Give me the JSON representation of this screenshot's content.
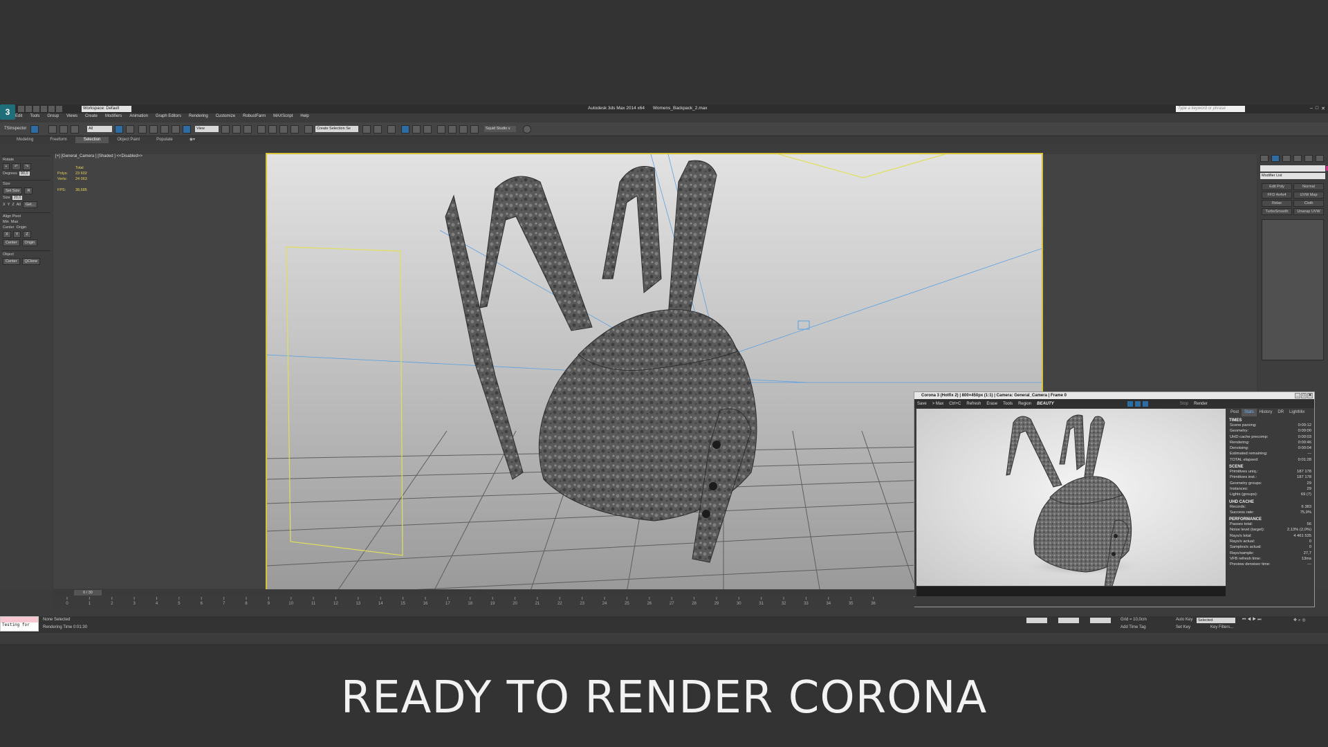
{
  "app": {
    "window_title": "Autodesk 3ds Max  2014 x64",
    "file_name": "Womens_Backpack_2.max",
    "workspace": "Workspace: Default",
    "search_placeholder": "Type a keyword or phrase"
  },
  "menu": [
    "Edit",
    "Tools",
    "Group",
    "Views",
    "Create",
    "Modifiers",
    "Animation",
    "Graph Editors",
    "Rendering",
    "Customize",
    "RobustFarm",
    "MAXScript",
    "Help"
  ],
  "toolbar": {
    "tsinspector": "TSInspector",
    "selection_filter": "All",
    "ref_coord": "View",
    "named_selection": "Create Selection Se",
    "squid": "Squid Studio v"
  },
  "ribbon_tabs": [
    "Modeling",
    "Freeform",
    "Selection",
    "Object Paint",
    "Populate"
  ],
  "ribbon_active": "Selection",
  "left_panel": {
    "rotate_title": "Rotate",
    "degrees_label": "Degrees",
    "degrees_value": "90,0",
    "size_title": "Size",
    "set_size": "Set Size",
    "r_label": "R",
    "size_label": "Size",
    "size_value": "20,0",
    "x": "X",
    "y": "Y",
    "z": "Z",
    "all": "All",
    "get": "Get...",
    "align_title": "Align Pivot",
    "min": "Min",
    "max": "Max",
    "center": "Center",
    "origin": "Origin",
    "object_title": "Object",
    "qclone": "QClone"
  },
  "viewport": {
    "label": "[+] [General_Camera ] [Shaded ]  <<Disabled>>",
    "stats_header": "Total",
    "polys_label": "Polys:",
    "polys_value": "23 602",
    "verts_label": "Verts:",
    "verts_value": "24 063",
    "fps_label": "FPS:",
    "fps_value": "38,685"
  },
  "right_panel": {
    "modifier_list": "Modifier List",
    "buttons": [
      "Edit Poly",
      "Normal",
      "FFD 4x4x4",
      "UVW Map",
      "Relax",
      "Cloth",
      "TurboSmooth",
      "Unwrap UVW"
    ],
    "swatch_color": "#d8348b"
  },
  "corona": {
    "title": "Corona 3 (Hotfix 2) | 800×450px (1:1) | Camera: General_Camera | Frame 0",
    "toolbar": [
      "Save",
      "> Max",
      "Ctrl+C",
      "Refresh",
      "Erase",
      "Tools",
      "Region"
    ],
    "beauty": "BEAUTY",
    "stop": "Stop",
    "render": "Render",
    "tabs": [
      "Post",
      "Stats",
      "History",
      "DR",
      "LightMix"
    ],
    "active_tab": "Stats",
    "sections": [
      {
        "title": "TIMES",
        "rows": [
          [
            "Scene parsing:",
            "0:00:12"
          ],
          [
            "Geometry:",
            "0:00:00"
          ],
          [
            "UHD cache precomp:",
            "0:00:03"
          ],
          [
            "Rendering:",
            "0:00:46"
          ],
          [
            "Denoising:",
            "0:00:04"
          ],
          [
            "Estimated remaining:",
            "---"
          ],
          [
            "TOTAL elapsed:",
            "0:01:28"
          ]
        ]
      },
      {
        "title": "SCENE",
        "rows": [
          [
            "Primitives uniq.:",
            "187 178"
          ],
          [
            "Primitives inst.:",
            "187 178"
          ],
          [
            "Geometry groups:",
            "29"
          ],
          [
            "Instances:",
            "29"
          ],
          [
            "Lights (groups):",
            "69 (7)"
          ]
        ]
      },
      {
        "title": "UHD CACHE",
        "rows": [
          [
            "Records:",
            "6 383"
          ],
          [
            "Success rate:",
            "75,9%"
          ]
        ]
      },
      {
        "title": "PERFORMANCE",
        "rows": [
          [
            "Passes total:",
            "56"
          ],
          [
            "Noise level (target):",
            "2,13% (2,0%)"
          ],
          [
            "Rays/s total:",
            "4 461 535"
          ],
          [
            "Rays/s actual:",
            "0"
          ],
          [
            "Samples/s actual:",
            "0"
          ],
          [
            "Rays/sample:",
            "27,7"
          ],
          [
            "VFB refresh time:",
            "13ms"
          ],
          [
            "Preview denoiser time:",
            "---"
          ]
        ]
      }
    ]
  },
  "timeline": {
    "slider": "0 / 30",
    "ticks": [
      "0",
      "1",
      "2",
      "3",
      "4",
      "5",
      "6",
      "7",
      "8",
      "9",
      "10",
      "11",
      "12",
      "13",
      "14",
      "15",
      "16",
      "17",
      "18",
      "19",
      "20",
      "21",
      "22",
      "23",
      "24",
      "25",
      "26",
      "27",
      "28",
      "29",
      "30",
      "31",
      "32",
      "33",
      "34",
      "35",
      "36"
    ]
  },
  "status": {
    "maxscript": "Testing for",
    "selected": "None Selected",
    "render_time": "Rendering Time  0:01:30",
    "grid": "Grid = 10,0cm",
    "add_time_tag": "Add Time Tag",
    "auto_key": "Auto Key",
    "set_key": "Set Key",
    "key_mode": "Selected",
    "key_filters": "Key Filters..."
  },
  "caption": "READY TO RENDER  CORONA"
}
